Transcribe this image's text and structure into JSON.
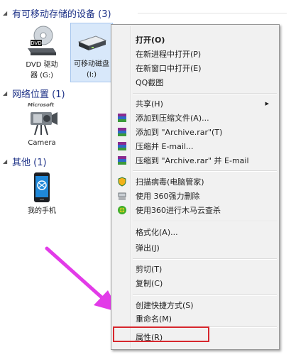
{
  "groups": {
    "removable": {
      "title": "有可移动存储的设备 (3)"
    },
    "network": {
      "title": "网络位置 (1)"
    },
    "other": {
      "title": "其他 (1)"
    }
  },
  "devices": {
    "dvd": {
      "line1": "DVD 驱动",
      "line2": "器 (G:)"
    },
    "removable_disk": {
      "line1": "可移动磁盘",
      "line2": "(I:)"
    },
    "camera": {
      "label": "Camera"
    },
    "phone": {
      "label": "我的手机"
    }
  },
  "context_menu": {
    "open": "打开(O)",
    "open_new_process": "在新进程中打开(P)",
    "open_new_window": "在新窗口中打开(E)",
    "qq_screenshot": "QQ截图",
    "share": "共享(H)",
    "add_archive": "添加到压缩文件(A)...",
    "add_archive_rar": "添加到 \"Archive.rar\"(T)",
    "compress_email": "压缩并 E-mail...",
    "compress_rar_email": "压缩到 \"Archive.rar\" 并 E-mail",
    "scan_virus": "扫描病毒(电脑管家)",
    "force_delete": "使用 360强力删除",
    "trojan_scan": "使用360进行木马云查杀",
    "format": "格式化(A)...",
    "eject": "弹出(J)",
    "cut": "剪切(T)",
    "copy": "复制(C)",
    "create_shortcut": "创建快捷方式(S)",
    "rename": "重命名(M)",
    "properties": "属性(R)"
  },
  "camera_brand": "Microsoft",
  "colors": {
    "group_title": "#1e3287",
    "highlight_box": "#d7272d",
    "arrow": "#e23be8",
    "selection": "#d8e8fa"
  }
}
